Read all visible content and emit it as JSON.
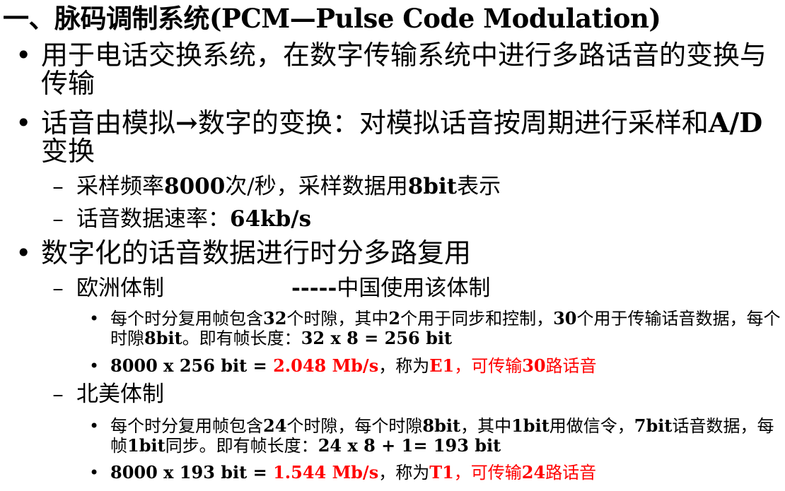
{
  "title": "一、脉码调制系统(PCM—Pulse Code Modulation)",
  "bullets": {
    "b1": {
      "text": "用于电话交换系统，在数字传输系统中进行多路话音的变换与传输"
    },
    "b2": {
      "text_a": "话音由模拟",
      "arrow": "→",
      "text_b": "数字的变换：对模拟话音按周期进行采样和",
      "text_c": "A/D",
      "text_d": "变换",
      "sub1": {
        "a": "采样频率",
        "b": "8000",
        "c": "次/秒，采样数据用",
        "d": "8bit",
        "e": "表示"
      },
      "sub2": {
        "a": "话音数据速率：",
        "b": "64kb/s"
      }
    },
    "b3": {
      "text": "数字化的话音数据进行时分多路复用",
      "europe": {
        "label": "欧洲体制",
        "note_dash": "-----",
        "note": "中国使用该体制",
        "p1": {
          "a": "每个时分复用帧包含",
          "b": "32",
          "c": "个时隙，其中",
          "d": "2",
          "e": "个用于同步和控制，",
          "f": "30",
          "g": "个用于传输话音数据，每个时隙",
          "h": "8bit",
          "i": "。即有帧长度：",
          "j": "32 x 8 = 256 bit"
        },
        "p2": {
          "a": "8000 x 256 bit = ",
          "b": "2.048 Mb/s",
          "c": "，称为",
          "d": "E1",
          "e": "，可传输",
          "f": "30",
          "g": "路话音"
        }
      },
      "na": {
        "label": "北美体制",
        "p1": {
          "a": "每个时分复用帧包含",
          "b": "24",
          "c": "个时隙，每个时隙",
          "d": "8bit",
          "e": "，其中",
          "f": "1bit",
          "g": "用做信令，",
          "h": "7bit",
          "i": "话音数据，每帧",
          "j": "1bit",
          "k": "同步。即有帧长度：",
          "l": "24 x 8 + 1= 193 bit"
        },
        "p2": {
          "a": "8000 x 193 bit = ",
          "b": "1.544 Mb/s",
          "c": "，称为",
          "d": "T1",
          "e": "，可传输",
          "f": "24",
          "g": "路话音"
        }
      }
    }
  },
  "symbols": {
    "bullet": "•",
    "dash": "–"
  },
  "colors": {
    "text": "#000000",
    "highlight": "#ff0000",
    "background": "#ffffff"
  }
}
